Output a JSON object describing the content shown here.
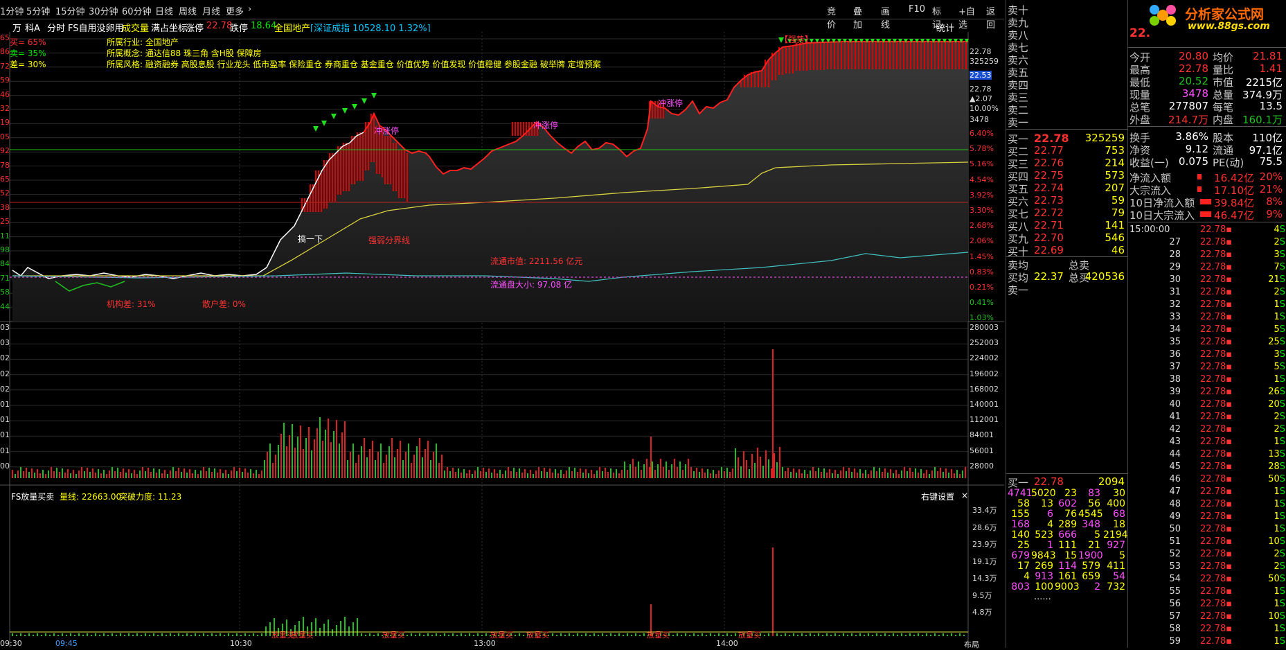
{
  "toolbar": {
    "tabs": [
      "1分钟",
      "5分钟",
      "15分钟",
      "30分钟",
      "60分钟",
      "日线",
      "周线",
      "月线",
      "更多",
      "›"
    ],
    "right_buttons": [
      "竞价",
      "叠加",
      "画线",
      "F10",
      "标记",
      "+自选",
      "返回"
    ]
  },
  "infobar": {
    "items": [
      "万",
      "科A",
      "分时",
      "FS自用没卵用",
      "成交量",
      "满占坐标",
      "涨停",
      "22.78",
      "跌停",
      "18.64",
      "全国地产"
    ],
    "index": "[深证成指 10528.10 1.32%]",
    "stat_btn": "统计"
  },
  "overlay": {
    "buy_pct": "买= 65%",
    "sell_pct": "卖= 35%",
    "diff_pct": "差= 30%",
    "industry": "所属行业: 全国地产",
    "concept": "所属概念: 通达信88 珠三角 含H股 保障房",
    "style": "所属风格: 融资融券 高股息股 行业龙头 低市盈率 保险重仓 券商重仓 基金重仓 价值优势 价值发现 价值稳健 参股金融 破举牌 定增预案"
  },
  "annotations": {
    "strong": "【强势】",
    "limit1": "冲涨停",
    "limit2": "冲涨停",
    "limit3": "冲涨停",
    "grab": "搞一下",
    "strongweak": "强弱分界线",
    "float_cap": "流通市值: 2211.56 亿元",
    "float_plate": "流通盘大小: 97.08 亿",
    "inst_diff": "机构差: 31%",
    "retail_diff": "散户差: 0%",
    "bottom_marks": [
      "放量买",
      "放量买",
      "放量买",
      "放量买",
      "放量买",
      "放量买",
      "放量买"
    ]
  },
  "price_axis_right": [
    "22.78",
    "325259",
    "22.53",
    "22.78",
    "▲2.07",
    "10.00%",
    "3478",
    "6.40%",
    "5.78%",
    "5.16%",
    "4.54%",
    "3.92%",
    "3.30%",
    "2.68%",
    "2.06%",
    "1.45%",
    "0.83%",
    "0.21%",
    "0.41%",
    "1.03%"
  ],
  "price_axis_left": [
    "65",
    "86",
    "72",
    "59",
    "46",
    "32",
    "19",
    "05",
    "92",
    "78",
    "65",
    "52",
    "38",
    "25",
    "11",
    "98",
    "84",
    "71",
    "58",
    "44"
  ],
  "volume_axis_right": [
    "280003",
    "252003",
    "224002",
    "196002",
    "168002",
    "140001",
    "112001",
    "84001",
    "56001",
    "28000"
  ],
  "volume_axis_left": [
    "03",
    "03",
    "02",
    "02",
    "02",
    "01",
    "01",
    "01",
    "01",
    "00"
  ],
  "bottom_panel": {
    "title": "FS放量买卖",
    "line": "量线: 22663.00",
    "power": "突破力度: 11.23",
    "settings": "右键设置",
    "close": "×",
    "axis": [
      "33.4万",
      "28.6万",
      "23.9万",
      "19.1万",
      "14.3万",
      "9.5万",
      "4.8万"
    ]
  },
  "time_axis": [
    "09:30",
    "09:45",
    "10:30",
    "13:00",
    "14:00",
    "布局"
  ],
  "chart_data": {
    "type": "line",
    "title": "",
    "x": [
      "09:30",
      "10:30",
      "11:30/13:00",
      "14:00",
      "15:00"
    ],
    "series": [
      {
        "name": "price",
        "values": [
          22.53,
          22.55,
          22.65,
          22.9,
          22.78
        ]
      }
    ],
    "ylabel": "",
    "ylim": [
      18.64,
      22.78
    ]
  },
  "order_book": {
    "sells": [
      {
        "k": "卖十"
      },
      {
        "k": "卖九"
      },
      {
        "k": "卖八"
      },
      {
        "k": "卖七"
      },
      {
        "k": "卖六"
      },
      {
        "k": "卖五"
      },
      {
        "k": "卖四"
      },
      {
        "k": "卖三"
      },
      {
        "k": "卖二"
      },
      {
        "k": "卖一"
      }
    ],
    "buys": [
      {
        "k": "买一",
        "p": "22.78",
        "v": "325259"
      },
      {
        "k": "买二",
        "p": "22.77",
        "v": "753"
      },
      {
        "k": "买三",
        "p": "22.76",
        "v": "214"
      },
      {
        "k": "买四",
        "p": "22.75",
        "v": "573"
      },
      {
        "k": "买五",
        "p": "22.74",
        "v": "207"
      },
      {
        "k": "买六",
        "p": "22.73",
        "v": "59"
      },
      {
        "k": "买七",
        "p": "22.72",
        "v": "79"
      },
      {
        "k": "买八",
        "p": "22.71",
        "v": "141"
      },
      {
        "k": "买九",
        "p": "22.70",
        "v": "546"
      },
      {
        "k": "买十",
        "p": "22.69",
        "v": "46"
      }
    ],
    "avg_sell_label": "卖均",
    "total_sell_label": "总卖",
    "avg_buy_label": "买均",
    "avg_buy": "22.37",
    "total_buy_label": "总买",
    "total_buy": "420536",
    "sell1_label": "卖一",
    "queue_label": "买一",
    "queue_price": "22.78",
    "queue_total": "2094",
    "queue": [
      [
        "4741",
        "5020",
        "23",
        "83",
        "30"
      ],
      [
        "58",
        "13",
        "602",
        "56",
        "400"
      ],
      [
        "155",
        "6",
        "76",
        "4545",
        "68"
      ],
      [
        "168",
        "4",
        "289",
        "348",
        "18"
      ],
      [
        "140",
        "523",
        "666",
        "5",
        "2194"
      ],
      [
        "25",
        "1",
        "111",
        "21",
        "927"
      ],
      [
        "679",
        "9843",
        "15",
        "1900",
        "5"
      ],
      [
        "17",
        "269",
        "114",
        "579",
        "411"
      ],
      [
        "4",
        "913",
        "161",
        "659",
        "54"
      ],
      [
        "803",
        "100",
        "9003",
        "2",
        "732"
      ]
    ],
    "more": "......"
  },
  "stats": {
    "code_price": "22.",
    "rows": [
      {
        "a": "今开",
        "b": "20.80",
        "c": "均价",
        "d": "21.81"
      },
      {
        "a": "最高",
        "b": "22.78",
        "c": "量比",
        "d": "1.41"
      },
      {
        "a": "最低",
        "b": "20.52",
        "c": "市值",
        "d": "2215亿"
      },
      {
        "a": "现量",
        "b": "3478",
        "c": "总量",
        "d": "374.9万"
      },
      {
        "a": "总笔",
        "b": "277807",
        "c": "每笔",
        "d": "13.5"
      },
      {
        "a": "外盘",
        "b": "214.7万",
        "c": "内盘",
        "d": "160.1万"
      },
      {
        "a": "换手",
        "b": "3.86%",
        "c": "股本",
        "d": "110亿"
      },
      {
        "a": "净资",
        "b": "9.12",
        "c": "流通",
        "d": "97.1亿"
      },
      {
        "a": "收益(一)",
        "b": "0.075",
        "c": "PE(动)",
        "d": "75.5"
      }
    ],
    "flows": [
      {
        "a": "净流入额",
        "v": "16.42亿",
        "p": "20%"
      },
      {
        "a": "大宗流入",
        "v": "17.10亿",
        "p": "21%"
      },
      {
        "a": "10日净流入额",
        "v": "39.84亿",
        "p": "8%"
      },
      {
        "a": "10日大宗流入",
        "v": "46.47亿",
        "p": "9%"
      }
    ],
    "ticks": [
      {
        "t": "15:00:00",
        "p": "22.78",
        "v": "4",
        "s": "S"
      },
      {
        "t": "27",
        "p": "22.78",
        "v": "2",
        "s": "S"
      },
      {
        "t": "28",
        "p": "22.78",
        "v": "3",
        "s": "S"
      },
      {
        "t": "29",
        "p": "22.78",
        "v": "7",
        "s": "S"
      },
      {
        "t": "30",
        "p": "22.78",
        "v": "21",
        "s": "S"
      },
      {
        "t": "31",
        "p": "22.78",
        "v": "2",
        "s": "S"
      },
      {
        "t": "32",
        "p": "22.78",
        "v": "1",
        "s": "S"
      },
      {
        "t": "33",
        "p": "22.78",
        "v": "1",
        "s": "S"
      },
      {
        "t": "34",
        "p": "22.78",
        "v": "5",
        "s": "S"
      },
      {
        "t": "35",
        "p": "22.78",
        "v": "25",
        "s": "S"
      },
      {
        "t": "36",
        "p": "22.78",
        "v": "3",
        "s": "S"
      },
      {
        "t": "37",
        "p": "22.78",
        "v": "5",
        "s": "S"
      },
      {
        "t": "38",
        "p": "22.78",
        "v": "1",
        "s": "S"
      },
      {
        "t": "39",
        "p": "22.78",
        "v": "26",
        "s": "S"
      },
      {
        "t": "40",
        "p": "22.78",
        "v": "20",
        "s": "S"
      },
      {
        "t": "41",
        "p": "22.78",
        "v": "2",
        "s": "S"
      },
      {
        "t": "42",
        "p": "22.78",
        "v": "2",
        "s": "S"
      },
      {
        "t": "43",
        "p": "22.78",
        "v": "1",
        "s": "S"
      },
      {
        "t": "44",
        "p": "22.78",
        "v": "13",
        "s": "S"
      },
      {
        "t": "45",
        "p": "22.78",
        "v": "28",
        "s": "S"
      },
      {
        "t": "46",
        "p": "22.78",
        "v": "50",
        "s": "S"
      },
      {
        "t": "47",
        "p": "22.78",
        "v": "1",
        "s": "S"
      },
      {
        "t": "48",
        "p": "22.78",
        "v": "1",
        "s": "S"
      },
      {
        "t": "49",
        "p": "22.78",
        "v": "1",
        "s": "S"
      },
      {
        "t": "50",
        "p": "22.78",
        "v": "1",
        "s": "S"
      },
      {
        "t": "51",
        "p": "22.78",
        "v": "10",
        "s": "S"
      },
      {
        "t": "52",
        "p": "22.78",
        "v": "2",
        "s": "S"
      },
      {
        "t": "53",
        "p": "22.78",
        "v": "2",
        "s": "S"
      },
      {
        "t": "54",
        "p": "22.78",
        "v": "50",
        "s": "S"
      },
      {
        "t": "55",
        "p": "22.78",
        "v": "1",
        "s": "S"
      },
      {
        "t": "56",
        "p": "22.78",
        "v": "1",
        "s": "S"
      },
      {
        "t": "57",
        "p": "22.78",
        "v": "10",
        "s": "S"
      },
      {
        "t": "58",
        "p": "22.78",
        "v": "1",
        "s": "S"
      },
      {
        "t": "59",
        "p": "22.78",
        "v": "1",
        "s": "S"
      }
    ]
  },
  "logo": {
    "title": "分析家公式网",
    "url": "www.88gs.com"
  }
}
